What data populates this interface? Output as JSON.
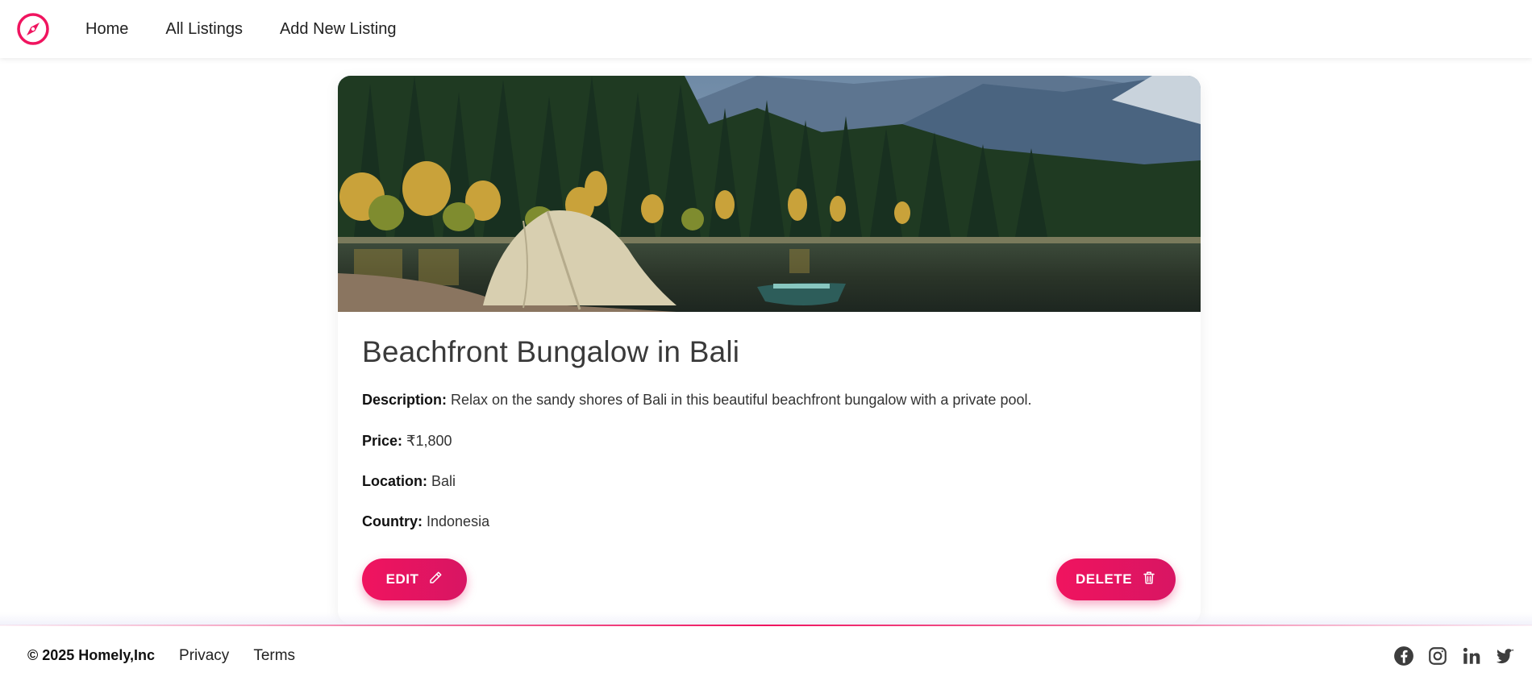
{
  "nav": {
    "logo_icon": "compass-icon",
    "links": [
      "Home",
      "All Listings",
      "Add New Listing"
    ]
  },
  "listing": {
    "image_alt": "tent-by-lake-photo",
    "title": "Beachfront Bungalow in Bali",
    "description_label": "Description:",
    "description": "Relax on the sandy shores of Bali in this beautiful beachfront bungalow with a private pool.",
    "price_label": "Price:",
    "price": "₹1,800",
    "location_label": "Location:",
    "location": "Bali",
    "country_label": "Country:",
    "country": "Indonesia"
  },
  "actions": {
    "edit_label": "EDIT",
    "edit_icon": "pencil-icon",
    "delete_label": "DELETE",
    "delete_icon": "trash-icon"
  },
  "footer": {
    "copyright": "© 2025 Homely,Inc",
    "links": [
      "Privacy",
      "Terms"
    ],
    "social_icons": [
      "facebook-icon",
      "instagram-icon",
      "linkedin-icon",
      "twitter-icon"
    ]
  },
  "colors": {
    "accent": "#f0145f",
    "text_dark": "#222222",
    "title": "#3a3a3a"
  }
}
